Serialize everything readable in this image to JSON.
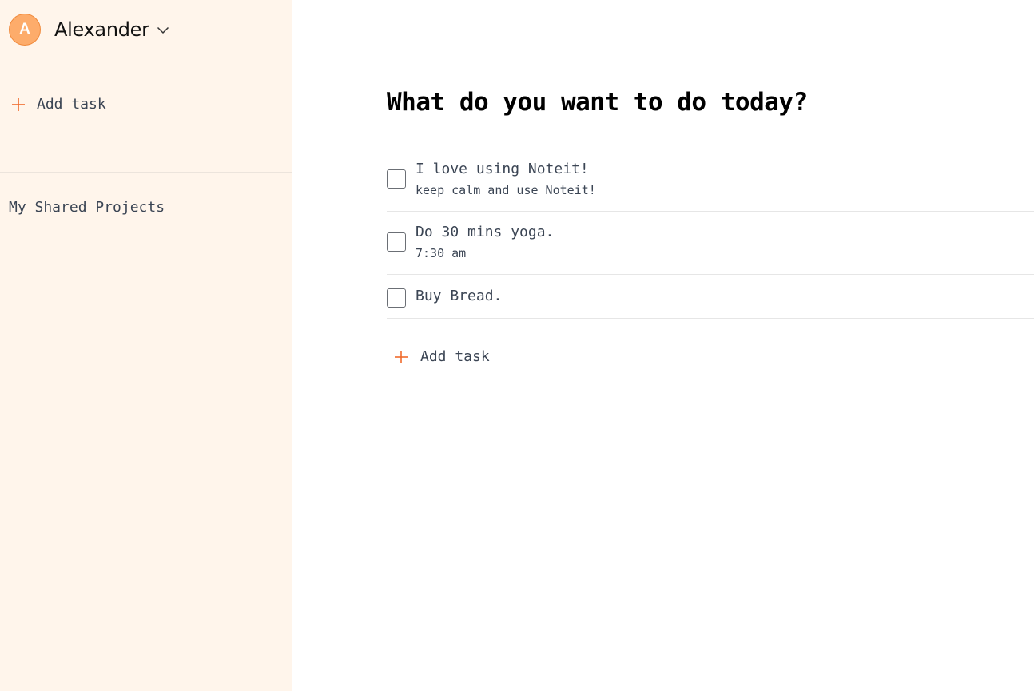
{
  "colors": {
    "sidebar_bg": "#fff5eb",
    "accent": "#f06a2c",
    "avatar_bg": "#fdac6b",
    "text": "#3b4554"
  },
  "sidebar": {
    "user": {
      "avatar_initial": "A",
      "name": "Alexander",
      "menu_icon": "chevron-down-icon"
    },
    "add_task": {
      "icon": "plus-icon",
      "label": "Add task"
    },
    "shared_projects_label": "My Shared Projects"
  },
  "main": {
    "heading": "What do you want to do today?",
    "tasks": [
      {
        "title": "I love using Noteit!",
        "description": "keep calm and use Noteit!",
        "checked": false
      },
      {
        "title": "Do 30 mins yoga.",
        "description": "7:30 am",
        "checked": false
      },
      {
        "title": "Buy Bread.",
        "checked": false
      }
    ],
    "add_task": {
      "icon": "plus-icon",
      "label": "Add task"
    }
  }
}
